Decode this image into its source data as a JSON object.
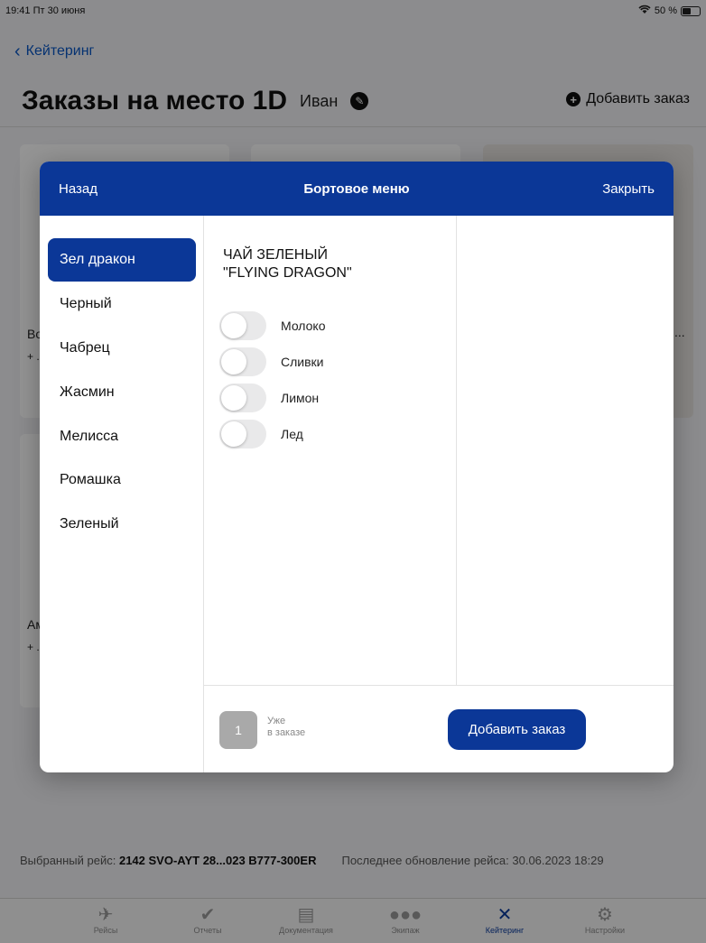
{
  "status_bar": {
    "time_date": "19:41  Пт 30 июня",
    "battery": "50 %"
  },
  "nav": {
    "back_label": "Кейтеринг"
  },
  "header": {
    "title": "Заказы на место 1D",
    "user": "Иван",
    "add_order": "Добавить заказ"
  },
  "background_cards": {
    "card1_text": "Во",
    "card1_sub": "+ ...",
    "card3_text": "...",
    "card4_text": "Ам",
    "card4_sub": "+ ..."
  },
  "modal": {
    "back_label": "Назад",
    "title": "Бортовое меню",
    "close_label": "Закрыть",
    "categories": [
      {
        "label": "Зел дракон",
        "selected": true
      },
      {
        "label": "Черный",
        "selected": false
      },
      {
        "label": "Чабрец",
        "selected": false
      },
      {
        "label": "Жасмин",
        "selected": false
      },
      {
        "label": "Мелисса",
        "selected": false
      },
      {
        "label": "Ромашка",
        "selected": false
      },
      {
        "label": "Зеленый",
        "selected": false
      }
    ],
    "product_title_line1": "ЧАЙ ЗЕЛЕНЫЙ",
    "product_title_line2": "\"FLYING DRAGON\"",
    "options": [
      {
        "label": "Молоко",
        "on": false
      },
      {
        "label": "Сливки",
        "on": false
      },
      {
        "label": "Лимон",
        "on": false
      },
      {
        "label": "Лед",
        "on": false
      }
    ],
    "quantity": "1",
    "quantity_caption_line1": "Уже",
    "quantity_caption_line2": "в заказе",
    "add_button": "Добавить заказ"
  },
  "footer": {
    "flight_label": "Выбранный рейс:",
    "flight_value": "2142 SVO-AYT 28...023 B777-300ER",
    "update_label": "Последнее обновление рейса: 30.06.2023 18:29"
  },
  "tabs": [
    {
      "label": "Рейсы",
      "icon": "airplane-icon",
      "active": false
    },
    {
      "label": "Отчеты",
      "icon": "check-circle-icon",
      "active": false
    },
    {
      "label": "Документация",
      "icon": "document-icon",
      "active": false
    },
    {
      "label": "Экипаж",
      "icon": "crew-icon",
      "active": false
    },
    {
      "label": "Кейтеринг",
      "icon": "catering-icon",
      "active": true
    },
    {
      "label": "Настройки",
      "icon": "settings-icon",
      "active": false
    }
  ],
  "colors": {
    "accent": "#0b3797",
    "link": "#0a56c4"
  }
}
